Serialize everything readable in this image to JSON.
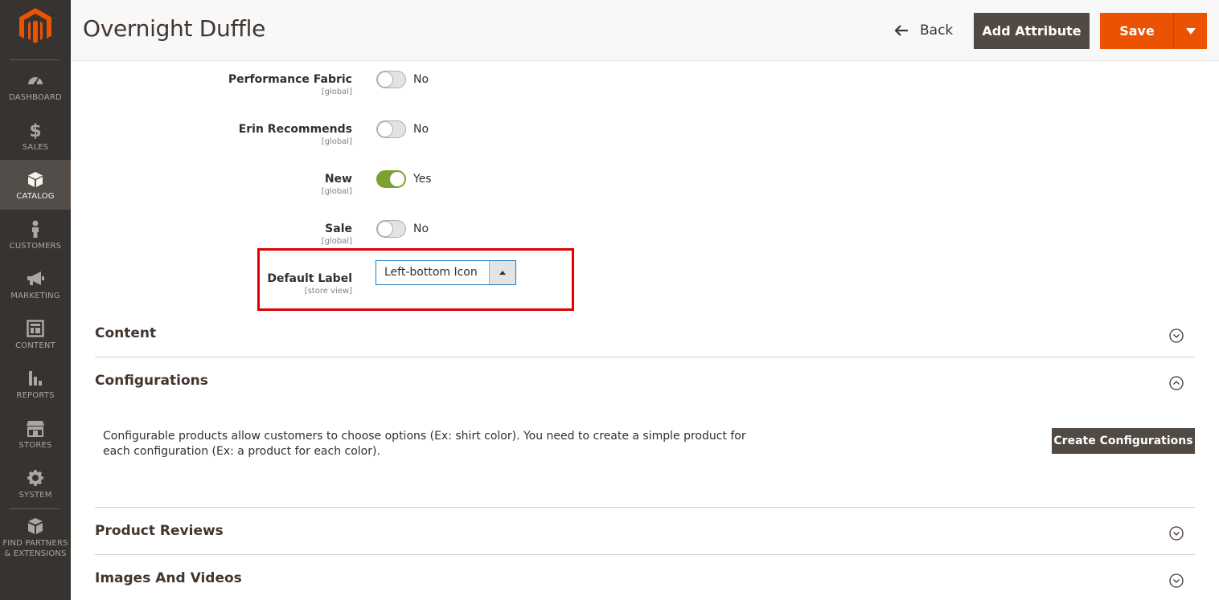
{
  "sidebar": {
    "items": [
      {
        "label": "DASHBOARD",
        "icon": "dashboard-icon"
      },
      {
        "label": "SALES",
        "icon": "dollar-icon"
      },
      {
        "label": "CATALOG",
        "icon": "cube-icon"
      },
      {
        "label": "CUSTOMERS",
        "icon": "person-icon"
      },
      {
        "label": "MARKETING",
        "icon": "megaphone-icon"
      },
      {
        "label": "CONTENT",
        "icon": "layout-icon"
      },
      {
        "label": "REPORTS",
        "icon": "bar-chart-icon"
      },
      {
        "label": "STORES",
        "icon": "storefront-icon"
      },
      {
        "label": "SYSTEM",
        "icon": "gear-icon"
      }
    ],
    "partners_line1": "FIND PARTNERS",
    "partners_line2": "& EXTENSIONS",
    "active_color": "#524d49",
    "background_color": "#373330"
  },
  "header": {
    "title": "Overnight Duffle",
    "back_label": "Back",
    "add_attribute_label": "Add Attribute",
    "save_label": "Save",
    "accent_color": "#eb5202"
  },
  "fields": [
    {
      "label": "Performance Fabric",
      "scope": "[global]",
      "value": "No",
      "on": false
    },
    {
      "label": "Erin Recommends",
      "scope": "[global]",
      "value": "No",
      "on": false
    },
    {
      "label": "New",
      "scope": "[global]",
      "value": "Yes",
      "on": true
    },
    {
      "label": "Sale",
      "scope": "[global]",
      "value": "No",
      "on": false
    }
  ],
  "default_label": {
    "label": "Default Label",
    "scope": "[store view]",
    "selected": "Left-bottom Icon"
  },
  "sections": {
    "content": "Content",
    "configurations": "Configurations",
    "configurations_text": "Configurable products allow customers to choose options (Ex: shirt color). You need to create a simple product for each configuration (Ex: a product for each color).",
    "create_configurations_label": "Create Configurations",
    "product_reviews": "Product Reviews",
    "images_and_videos": "Images And Videos"
  }
}
